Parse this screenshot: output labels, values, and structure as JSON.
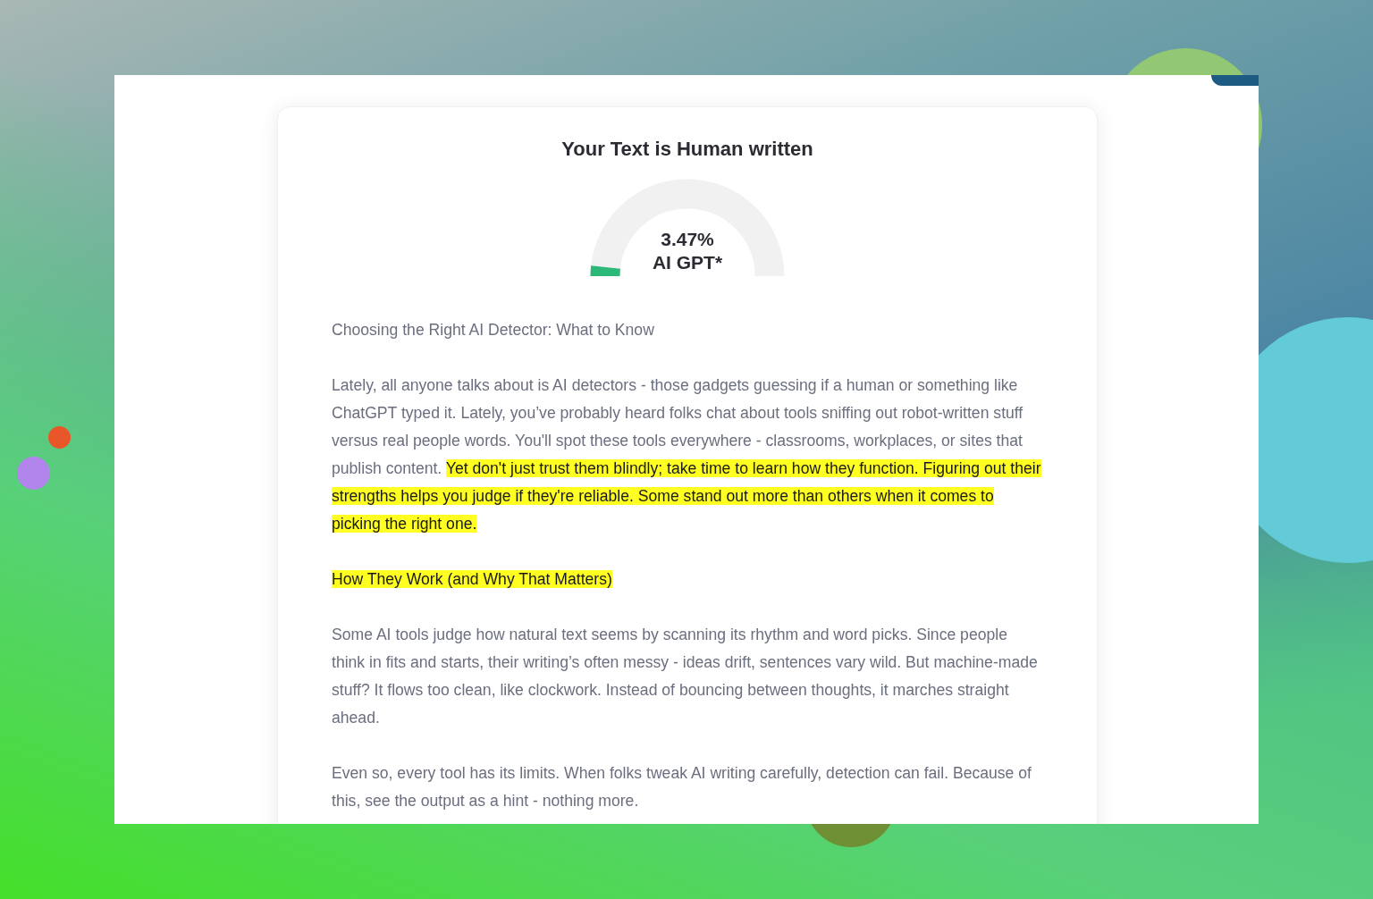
{
  "result": {
    "title": "Your Text is Human written",
    "gauge": {
      "level": 0.0347,
      "value": "3.47%",
      "label": "AI GPT*"
    }
  },
  "paragraphs": [
    {
      "segments": [
        {
          "text": "Choosing the Right AI Detector: What to Know",
          "highlighted": false
        }
      ]
    },
    {
      "segments": [
        {
          "text": "Lately, all anyone talks about is AI detectors - those gadgets guessing if a human or something like ChatGPT typed it. Lately, you’ve probably heard folks chat about tools sniffing out robot-written stuff versus real people words. You'll spot these tools everywhere - classrooms, workplaces, or sites that publish content. ",
          "highlighted": false
        },
        {
          "text": "Yet don't just trust them blindly; take time to learn how they function. ",
          "highlighted": true
        },
        {
          "text": "Figuring out their strengths helps you judge if they're reliable. ",
          "highlighted": true
        },
        {
          "text": "Some stand out more than others when it comes to picking the right one.",
          "highlighted": true
        }
      ]
    },
    {
      "segments": [
        {
          "text": "How They Work (and Why That Matters)",
          "highlighted": true
        }
      ]
    },
    {
      "segments": [
        {
          "text": "Some AI tools judge how natural text seems by scanning its rhythm and word picks. Since people think in fits and starts, their writing’s often messy - ideas drift, sentences vary wild. But machine-made stuff? It flows too clean, like clockwork. Instead of bouncing between thoughts, it marches straight ahead.",
          "highlighted": false
        }
      ]
    },
    {
      "segments": [
        {
          "text": "Even so, every tool has its limits. When folks tweak AI writing carefully, detection can fail. Because of this, see the output as a hint - nothing more.",
          "highlighted": false
        }
      ]
    }
  ]
}
